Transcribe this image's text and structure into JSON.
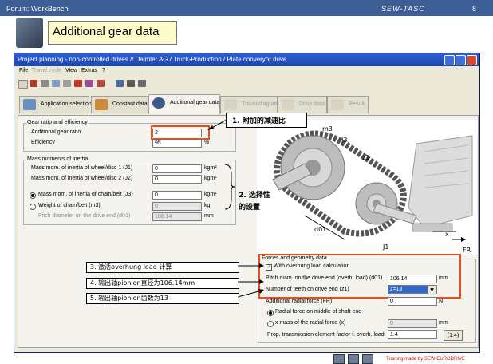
{
  "slide": {
    "forum": "Forum: WorkBench",
    "brand": "SEW-TASC",
    "page_number": "8",
    "title": "Additional gear data",
    "footer": "Training made by  SEW-EURODRIVE"
  },
  "window": {
    "title": "Project planning - non-controlled drives //      Daimler AG / Truck-Production / Plate converyor drive"
  },
  "menu": [
    "File",
    "Travel cycle",
    "View",
    "Extras",
    "?"
  ],
  "tabs": [
    {
      "label": "Application selection"
    },
    {
      "label": "Constant data"
    },
    {
      "label": "Additional gear data"
    },
    {
      "label": "Travel diagram"
    },
    {
      "label": "Drive data"
    },
    {
      "label": "Result"
    }
  ],
  "gear_ratio": {
    "group_title": "Gear ratio and efficiency",
    "additional_gear_ratio_label": "Additional gear ratio",
    "additional_gear_ratio_value": "2",
    "efficiency_label": "Efficiency",
    "efficiency_value": "95",
    "efficiency_unit": "%"
  },
  "inertia": {
    "group_title": "Mass moments of inertia",
    "j1_label": "Mass mom. of inertia of wheel/disc 1 (J1)",
    "j1_value": "0",
    "j1_unit": "kgm²",
    "j2_label": "Mass mom. of inertia of wheel/disc 2 (J2)",
    "j2_value": "0",
    "j2_unit": "kgm²",
    "j3_label": "Mass mom. of inertia of chain/belt (J3)",
    "j3_value": "0",
    "j3_unit": "kgm²",
    "m3_label": "Weight of chain/belt (m3)",
    "m3_value": "0",
    "m3_unit": "kg",
    "pitch_label": "Pitch diameter on the drive end (d01)",
    "pitch_value": "106.14",
    "pitch_unit": "mm"
  },
  "forces": {
    "group_title": "Forces and geometry data",
    "overhung_label": "With overhung load calculation",
    "pitch_diam_label": "Pitch diam. on the drive end (overh. load) (d01)",
    "pitch_diam_value": "106.14",
    "pitch_diam_unit": "mm",
    "teeth_label": "Number of teeth on drive end (z1)",
    "teeth_value": "z=13",
    "radial_force_label": "Additional radial force (FR)",
    "radial_force_value": "0",
    "radial_force_unit": "N",
    "radial_middle_label": "Radial force on middle of shaft end",
    "x_mass_label": "x mass of the radial force (x)",
    "x_mass_value": "0",
    "x_mass_unit": "mm",
    "prop_label": "Prop. transmission element factor f. overh. load",
    "prop_value": "1.4",
    "prop_button": "(1.4)"
  },
  "diagram_labels": {
    "m3": "m3",
    "j3": "J3",
    "z1": "z1",
    "d01": "d01",
    "j1": "J1",
    "x": "x",
    "fr": "FR"
  },
  "annotations": {
    "a1": "1. 附加的减速比",
    "a2_line1": "2. 选择性",
    "a2_line2": "的设置",
    "a3": "3. 激活overhung load 计算",
    "a4": "4. 输出轴pionion直径为106.14mm",
    "a5": "5. 输出轴pionion齿数为13"
  },
  "colors": {
    "highlight": "#e84d1a",
    "titlebar": "#2c5fd4",
    "slide_header": "#3d5d95"
  }
}
